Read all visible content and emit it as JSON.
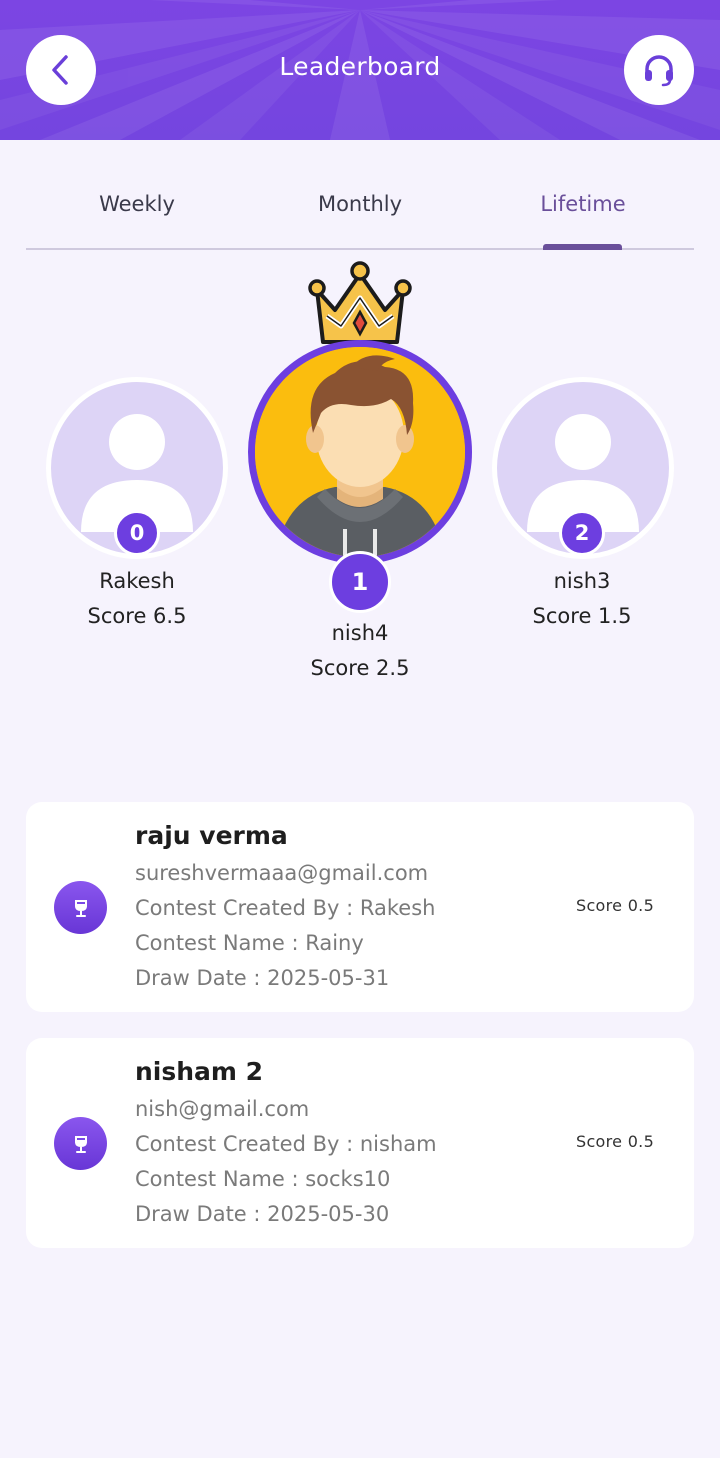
{
  "header": {
    "title": "Leaderboard",
    "back_icon": "chevron-left-icon",
    "support_icon": "headset-icon",
    "background_color": "#7b45e2"
  },
  "tabs": [
    {
      "label": "Weekly",
      "active": false
    },
    {
      "label": "Monthly",
      "active": false
    },
    {
      "label": "Lifetime",
      "active": true
    }
  ],
  "podium": {
    "first": {
      "rank": "1",
      "name": "nish4",
      "score": "Score 2.5"
    },
    "second": {
      "rank": "0",
      "name": "Rakesh",
      "score": "Score 6.5"
    },
    "third": {
      "rank": "2",
      "name": "nish3",
      "score": "Score 1.5"
    }
  },
  "entries": [
    {
      "name": "raju verma",
      "email": "sureshvermaaa@gmail.com",
      "created_by": "Contest Created By : Rakesh",
      "contest_name": "Contest Name : Rainy",
      "draw_date": "Draw Date : 2025-05-31",
      "score": "Score 0.5",
      "icon": "trophy-icon"
    },
    {
      "name": "nisham 2",
      "email": "nish@gmail.com",
      "created_by": "Contest Created By : nisham",
      "contest_name": "Contest Name : socks10",
      "draw_date": "Draw Date : 2025-05-30",
      "score": "Score 0.5",
      "icon": "trophy-icon"
    }
  ],
  "colors": {
    "accent": "#6d3ee0",
    "background": "#f6f3fd",
    "active_tab": "#6a4f9a"
  }
}
